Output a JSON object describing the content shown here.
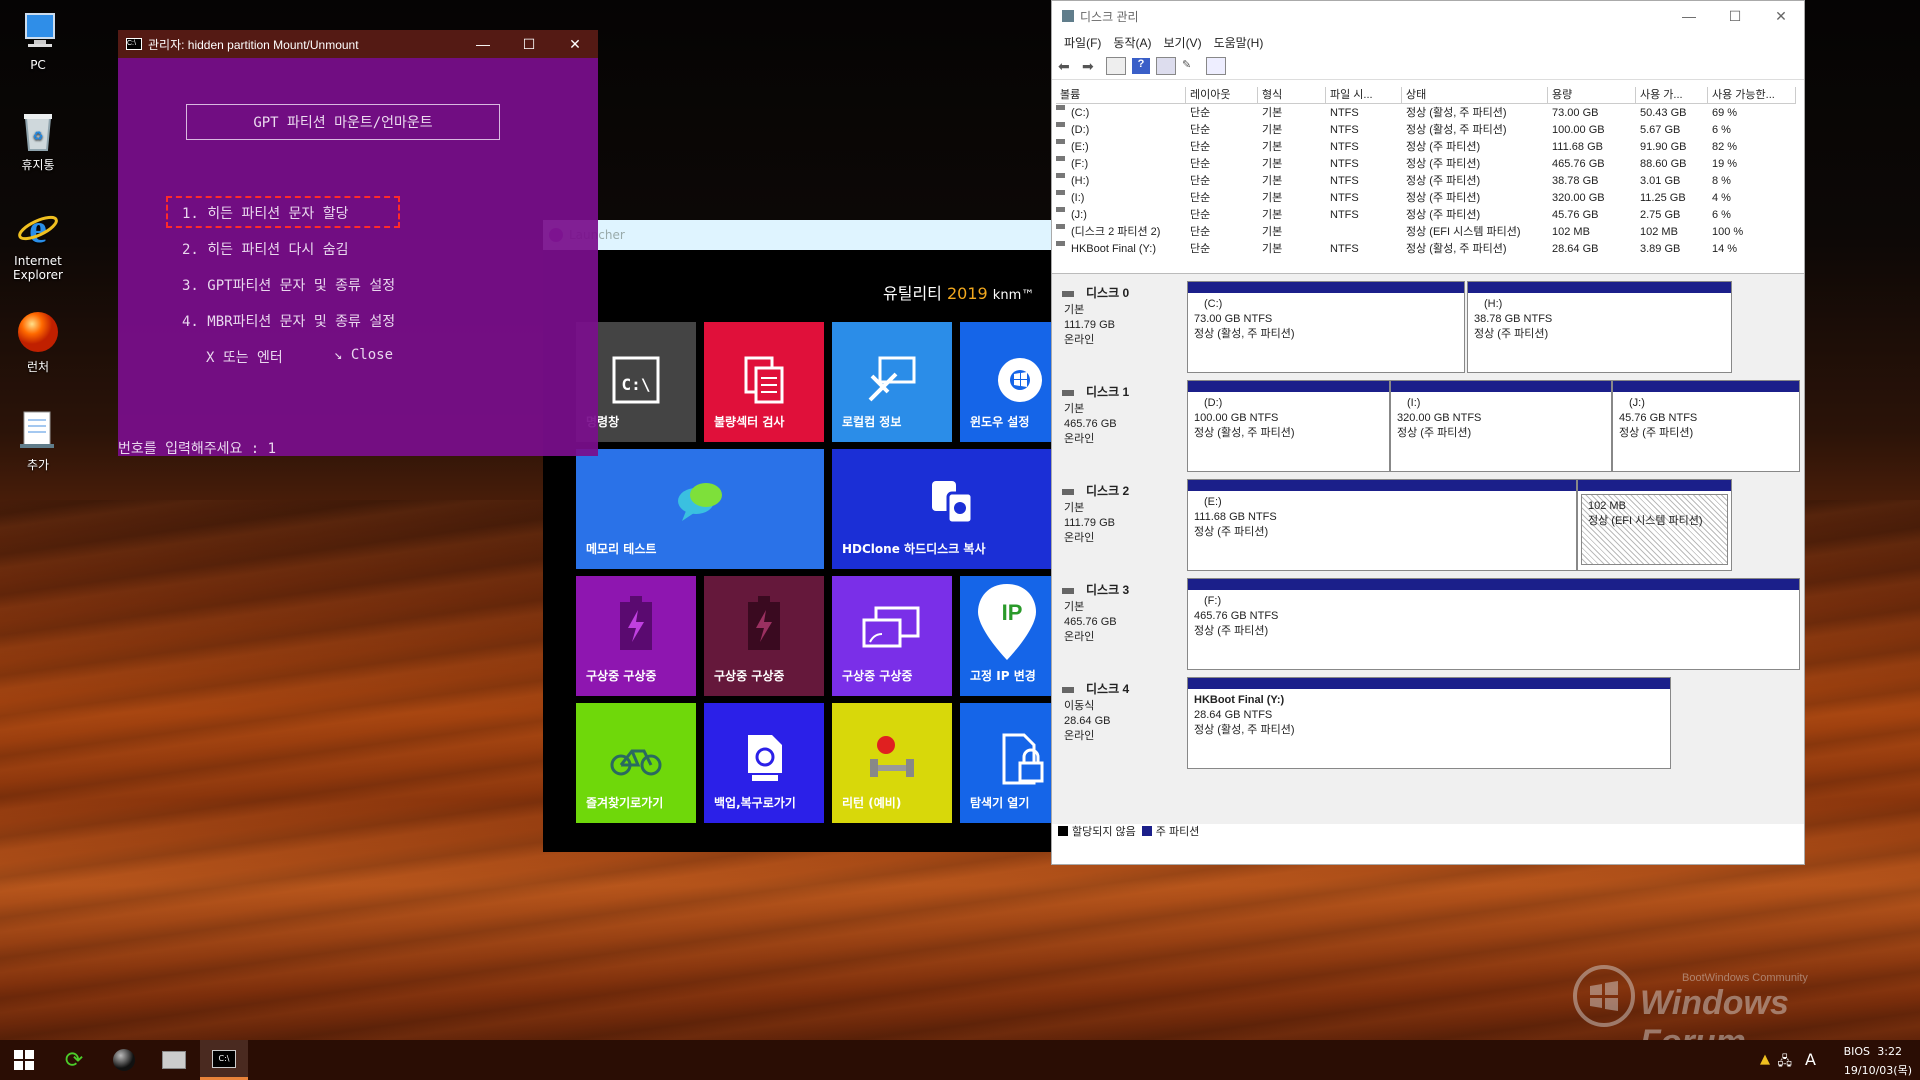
{
  "desktop": {
    "icons": [
      {
        "label": "PC",
        "icon": "pc-icon"
      },
      {
        "label": "휴지통",
        "icon": "recycle-bin-icon"
      },
      {
        "label": "Internet Explorer",
        "icon": "internet-explorer-icon"
      },
      {
        "label": "런처",
        "icon": "launcher-orb-icon"
      },
      {
        "label": "추가",
        "icon": "notepad-icon"
      }
    ],
    "watermark": "Windows Forum",
    "watermark_sub": "BootWindows Community"
  },
  "cmd": {
    "title": "관리자:  hidden partition Mount/Unmount",
    "header": "GPT 파티션 마운트/언마운트",
    "menu": [
      "1. 히든 파티션 문자 할당",
      "2. 히든 파티션 다시 숨김",
      "3. GPT파티션 문자 및 종류 설정",
      "4. MBR파티션 문자 및 종류 설정"
    ],
    "exit_left": "X 또는 엔터",
    "exit_right": "↘ Close",
    "prompt": "번호를 입력해주세요 : 1",
    "highlight_color": "#ff2a2a"
  },
  "launcher": {
    "header": "Launcher",
    "brand_prefix": "유틸리티",
    "brand_year": "2019",
    "brand_suffix": "knm™",
    "tiles": [
      {
        "label": "명령창",
        "color": "#444444",
        "icon": "cmd-icon"
      },
      {
        "label": "불량섹터 검사",
        "color": "#e0103a",
        "icon": "document-icon"
      },
      {
        "label": "로컬컴 정보",
        "color": "#2b8de8",
        "icon": "tools-icon"
      },
      {
        "label": "윈도우 설정",
        "color": "#1565e8",
        "icon": "windows-settings-icon"
      },
      {
        "label": "메모리 테스트",
        "color": "#2a72e8",
        "icon": "chat-bubbles-icon"
      },
      {
        "label": "HDClone 하드디스크 복사",
        "color": "#1b2fd6",
        "icon": "copy-disk-icon"
      },
      {
        "label": "구상중 구상중",
        "color": "#8e16b0",
        "icon": "battery-icon"
      },
      {
        "label": "구상중 구상중",
        "color": "#65183b",
        "icon": "battery-icon"
      },
      {
        "label": "구상중 구상중",
        "color": "#7a2fe8",
        "icon": "cast-icon"
      },
      {
        "label": "고정 IP 변경",
        "color": "#1565e8",
        "icon": "ip-icon"
      },
      {
        "label": "즐겨찾기로가기",
        "color": "#6fd80a",
        "icon": "bicycle-icon"
      },
      {
        "label": "백업,복구로가기",
        "color": "#2b20e8",
        "icon": "backup-icon"
      },
      {
        "label": "리턴 (예비)",
        "color": "#d8d80a",
        "icon": "dumbbell-icon"
      },
      {
        "label": "탐색기 열기",
        "color": "#1565e8",
        "icon": "lock-file-icon"
      }
    ]
  },
  "diskmgmt": {
    "title": "디스크 관리",
    "menu": [
      "파일(F)",
      "동작(A)",
      "보기(V)",
      "도움말(H)"
    ],
    "columns": [
      "볼륨",
      "레이아웃",
      "형식",
      "파일 시...",
      "상태",
      "용량",
      "사용 가...",
      "사용 가능한..."
    ],
    "volumes": [
      [
        "(C:)",
        "단순",
        "기본",
        "NTFS",
        "정상 (활성, 주 파티션)",
        "73.00 GB",
        "50.43 GB",
        "69 %"
      ],
      [
        "(D:)",
        "단순",
        "기본",
        "NTFS",
        "정상 (활성, 주 파티션)",
        "100.00 GB",
        "5.67 GB",
        "6 %"
      ],
      [
        "(E:)",
        "단순",
        "기본",
        "NTFS",
        "정상 (주 파티션)",
        "111.68 GB",
        "91.90 GB",
        "82 %"
      ],
      [
        "(F:)",
        "단순",
        "기본",
        "NTFS",
        "정상 (주 파티션)",
        "465.76 GB",
        "88.60 GB",
        "19 %"
      ],
      [
        "(H:)",
        "단순",
        "기본",
        "NTFS",
        "정상 (주 파티션)",
        "38.78 GB",
        "3.01 GB",
        "8 %"
      ],
      [
        "(I:)",
        "단순",
        "기본",
        "NTFS",
        "정상 (주 파티션)",
        "320.00 GB",
        "11.25 GB",
        "4 %"
      ],
      [
        "(J:)",
        "단순",
        "기본",
        "NTFS",
        "정상 (주 파티션)",
        "45.76 GB",
        "2.75 GB",
        "6 %"
      ],
      [
        "(디스크 2 파티션 2)",
        "단순",
        "기본",
        "",
        "정상 (EFI 시스템 파티션)",
        "102 MB",
        "102 MB",
        "100 %"
      ],
      [
        "HKBoot Final (Y:)",
        "단순",
        "기본",
        "NTFS",
        "정상 (활성, 주 파티션)",
        "28.64 GB",
        "3.89 GB",
        "14 %"
      ]
    ],
    "disks": [
      {
        "name": "디스크 0",
        "type": "기본",
        "size": "111.79 GB",
        "status": "온라인",
        "parts": [
          {
            "name": "(C:)",
            "size": "73.00 GB NTFS",
            "status": "정상 (활성, 주 파티션)"
          },
          {
            "name": "(H:)",
            "size": "38.78 GB NTFS",
            "status": "정상 (주 파티션)"
          }
        ]
      },
      {
        "name": "디스크 1",
        "type": "기본",
        "size": "465.76 GB",
        "status": "온라인",
        "parts": [
          {
            "name": "(D:)",
            "size": "100.00 GB NTFS",
            "status": "정상 (활성, 주 파티션)"
          },
          {
            "name": "(I:)",
            "size": "320.00 GB NTFS",
            "status": "정상 (주 파티션)"
          },
          {
            "name": "(J:)",
            "size": "45.76 GB NTFS",
            "status": "정상 (주 파티션)"
          }
        ]
      },
      {
        "name": "디스크 2",
        "type": "기본",
        "size": "111.79 GB",
        "status": "온라인",
        "parts": [
          {
            "name": "(E:)",
            "size": "111.68 GB NTFS",
            "status": "정상 (주 파티션)"
          },
          {
            "name": "",
            "size": "102 MB",
            "status": "정상 (EFI 시스템 파티션)"
          }
        ]
      },
      {
        "name": "디스크 3",
        "type": "기본",
        "size": "465.76 GB",
        "status": "온라인",
        "parts": [
          {
            "name": "(F:)",
            "size": "465.76 GB NTFS",
            "status": "정상 (주 파티션)"
          }
        ]
      },
      {
        "name": "디스크 4",
        "type": "이동식",
        "size": "28.64 GB",
        "status": "온라인",
        "parts": [
          {
            "name": "HKBoot Final  (Y:)",
            "size": "28.64 GB NTFS",
            "status": "정상 (활성, 주 파티션)"
          }
        ]
      }
    ],
    "legend": [
      {
        "label": "할당되지 않음",
        "color": "#000000"
      },
      {
        "label": "주 파티션",
        "color": "#1b1f8a"
      }
    ]
  },
  "taskbar": {
    "tray_ime": "A",
    "tray_bios": "BIOS",
    "clock_time": "3:22",
    "clock_date": "19/10/03(목)"
  }
}
